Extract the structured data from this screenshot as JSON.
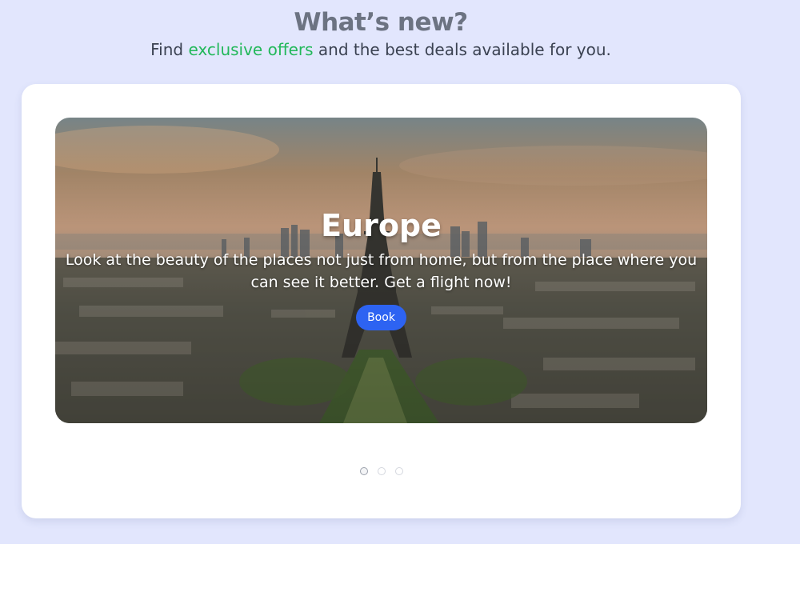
{
  "header": {
    "title": "What’s new?",
    "subtitle_prefix": "Find ",
    "subtitle_accent": "exclusive offers",
    "subtitle_suffix": " and the best deals available for you."
  },
  "carousel": {
    "slide": {
      "title": "Europe",
      "description": "Look at the beauty of the places not just from home, but from the place where you can see it better. Get a flight now!",
      "button_label": "Book",
      "image": "paris-eiffel-tower-skyline-photo"
    },
    "dot_count": 3,
    "active_index": 0
  },
  "colors": {
    "background": "#e2e6fd",
    "accent_text": "#22b85a",
    "button": "#2d63f2"
  }
}
